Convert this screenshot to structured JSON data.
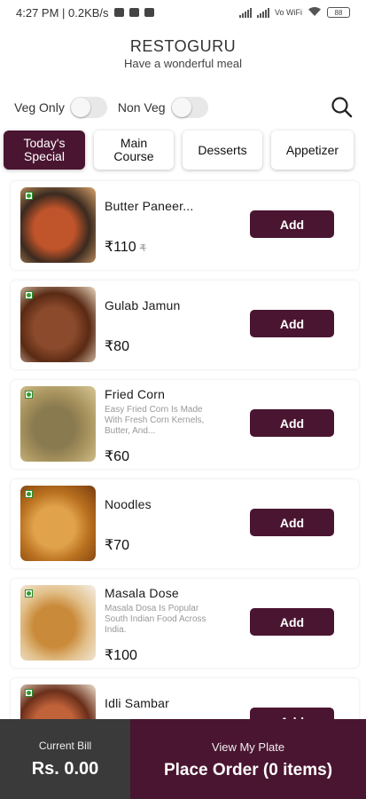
{
  "status_bar": {
    "time_network": "4:27 PM | 0.2KB/s",
    "network_label": "Vo WiFi",
    "battery": "88"
  },
  "header": {
    "title": "RESTOGURU",
    "subtitle": "Have a wonderful meal"
  },
  "filters": {
    "veg_only": "Veg Only",
    "non_veg": "Non Veg"
  },
  "tabs": [
    {
      "label": "Today's Special",
      "active": true
    },
    {
      "label": "Main Course",
      "active": false
    },
    {
      "label": "Desserts",
      "active": false
    },
    {
      "label": "Appetizer",
      "active": false
    }
  ],
  "items": [
    {
      "name": "Butter Paneer...",
      "description": "",
      "price": "₹110",
      "old_price": "₹",
      "add_label": "Add",
      "thumb_colors": [
        "#3b2a1f",
        "#c0542a",
        "#d9a36b"
      ]
    },
    {
      "name": "Gulab Jamun",
      "description": "",
      "price": "₹80",
      "add_label": "Add",
      "thumb_colors": [
        "#5a2a14",
        "#8b4a2b",
        "#e8d8c0"
      ]
    },
    {
      "name": "Fried Corn",
      "description": "Easy Fried Corn Is Made With Fresh Corn Kernels, Butter, And...",
      "price": "₹60",
      "add_label": "Add",
      "thumb_colors": [
        "#a9945e",
        "#8a7a50",
        "#d6c796"
      ]
    },
    {
      "name": "Noodles",
      "description": "",
      "price": "₹70",
      "add_label": "Add",
      "thumb_colors": [
        "#b9701f",
        "#e0a24a",
        "#7a3d10"
      ]
    },
    {
      "name": "Masala Dose",
      "description": "Masala Dosa Is Popular South Indian Food Across India.",
      "price": "₹100",
      "add_label": "Add",
      "thumb_colors": [
        "#e2c08a",
        "#c98a3a",
        "#f4efe6"
      ]
    },
    {
      "name": "Idli Sambar",
      "description": "",
      "price": "",
      "add_label": "Add",
      "thumb_colors": [
        "#6a2f1a",
        "#c0623a",
        "#efe2d0"
      ]
    }
  ],
  "bottom_bar": {
    "bill_label": "Current Bill",
    "bill_value": "Rs. 0.00",
    "view_plate_label": "View My Plate",
    "place_order_label": "Place Order (0 items)"
  },
  "colors": {
    "brand": "#4a1531",
    "bill_bg": "#3a3a3a",
    "veg": "#2e9e2e"
  }
}
